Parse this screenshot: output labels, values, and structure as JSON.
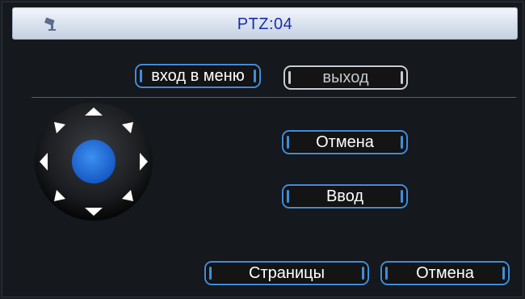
{
  "window": {
    "title": "PTZ:04",
    "icon": "camera-icon"
  },
  "menu": {
    "enter_menu_label": "вход в меню",
    "exit_label": "выход"
  },
  "ptz_control": {
    "directions": [
      "up",
      "up-right",
      "right",
      "down-right",
      "down",
      "down-left",
      "left",
      "up-left"
    ],
    "center": "center-button",
    "accent_color": "#1f6fd6"
  },
  "actions": {
    "cancel_label": "Отмена",
    "enter_label": "Ввод"
  },
  "footer": {
    "pages_label": "Страницы",
    "cancel_label": "Отмена"
  },
  "colors": {
    "button_border": "#3f8ddc",
    "title_text": "#1a2fa8",
    "background": "#15181c"
  }
}
